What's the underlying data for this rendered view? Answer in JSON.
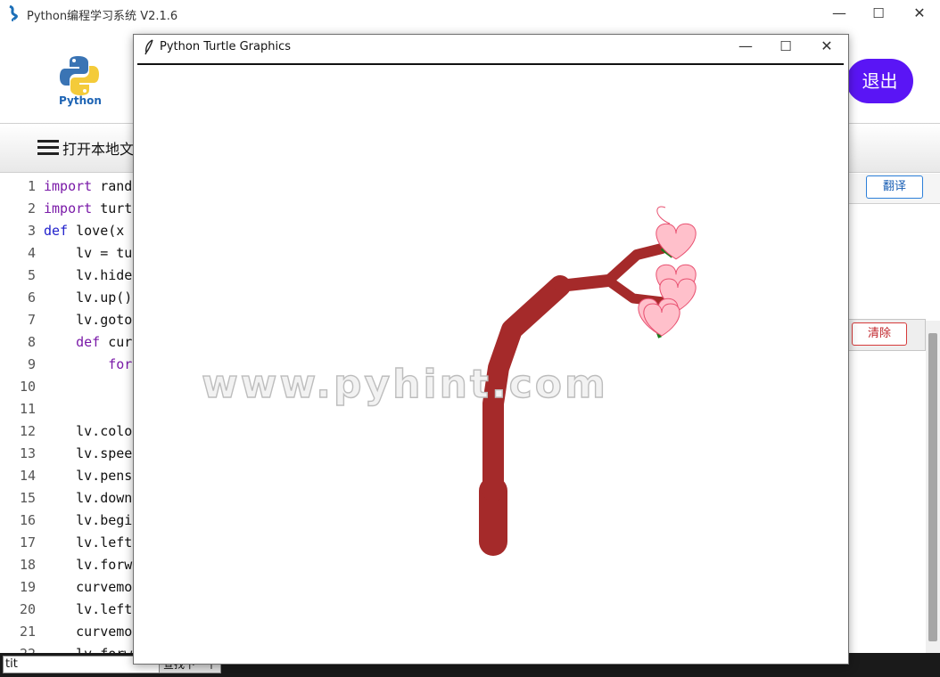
{
  "main_window": {
    "title": "Python编程学习系统 V2.1.6",
    "logo_text": "Python",
    "exit_label": "退出",
    "open_local_label": "打开本地文件",
    "translate_label": "翻译",
    "clear_label": "清除",
    "find_value": "tit",
    "find_next_label": "查找下一个",
    "min_glyph": "—",
    "max_glyph": "☐",
    "close_glyph": "✕"
  },
  "editor": {
    "lines": [
      {
        "n": "1",
        "kw": "import",
        "rest": " rand"
      },
      {
        "n": "2",
        "kw": "import",
        "rest": " turt"
      },
      {
        "n": "3",
        "kw2": "def",
        "rest": " love(x"
      },
      {
        "n": "4",
        "rest": "    lv = tu"
      },
      {
        "n": "5",
        "rest": "    lv.hide"
      },
      {
        "n": "6",
        "rest": "    lv.up()"
      },
      {
        "n": "7",
        "rest": "    lv.goto"
      },
      {
        "n": "8",
        "kwi": "    def",
        "rest": " cur"
      },
      {
        "n": "9",
        "kwi2": "        for",
        "rest": ""
      },
      {
        "n": "10",
        "rest": ""
      },
      {
        "n": "11",
        "rest": ""
      },
      {
        "n": "12",
        "rest": "    lv.colo"
      },
      {
        "n": "13",
        "rest": "    lv.spee"
      },
      {
        "n": "14",
        "rest": "    lv.pens"
      },
      {
        "n": "15",
        "rest": "    lv.down"
      },
      {
        "n": "16",
        "rest": "    lv.begi"
      },
      {
        "n": "17",
        "rest": "    lv.left"
      },
      {
        "n": "18",
        "rest": "    lv.forw"
      },
      {
        "n": "19",
        "rest": "    curvemo"
      },
      {
        "n": "20",
        "rest": "    lv.left"
      },
      {
        "n": "21",
        "rest": "    curvemo"
      },
      {
        "n": "22",
        "rest": "    lv.forw"
      }
    ]
  },
  "turtle_window": {
    "title": "Python Turtle Graphics",
    "watermark": "www.pyhint.com",
    "colors": {
      "trunk": "#a52a2a",
      "leaf": "#1a7a1a",
      "heart_fill": "#ffc0cb",
      "heart_stroke": "#e85070"
    }
  }
}
